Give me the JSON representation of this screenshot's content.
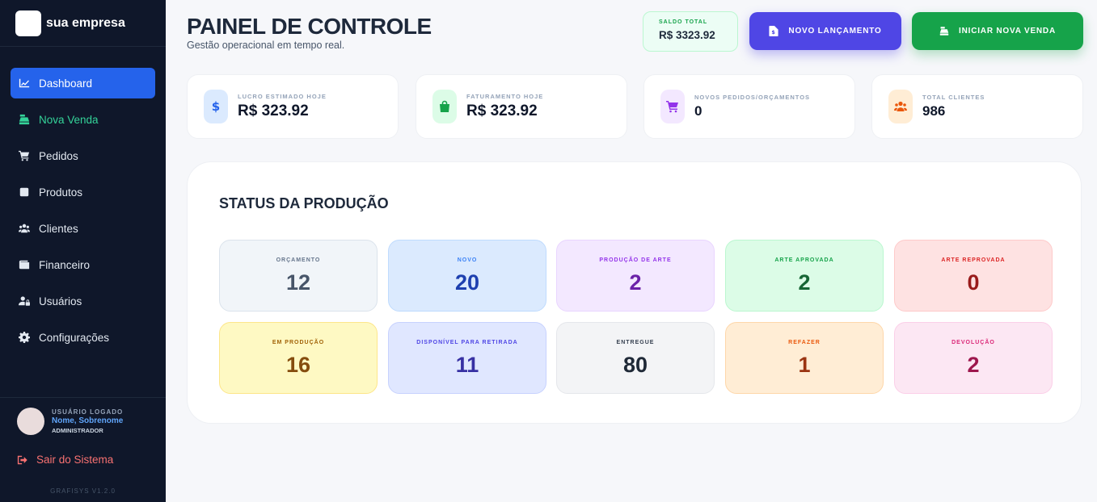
{
  "brand": {
    "name": "sua empresa"
  },
  "sidebar": {
    "items": [
      {
        "label": "Dashboard",
        "icon": "chart-line-icon"
      },
      {
        "label": "Nova Venda",
        "icon": "cash-register-icon"
      },
      {
        "label": "Pedidos",
        "icon": "cart-icon"
      },
      {
        "label": "Produtos",
        "icon": "box-icon"
      },
      {
        "label": "Clientes",
        "icon": "users-icon"
      },
      {
        "label": "Financeiro",
        "icon": "wallet-icon"
      },
      {
        "label": "Usuários",
        "icon": "user-lock-icon"
      },
      {
        "label": "Configurações",
        "icon": "gear-icon"
      }
    ],
    "active_index": 0,
    "user": {
      "caption": "USUÁRIO LOGADO",
      "name": "Nome, Sobrenome",
      "role": "ADMINISTRADOR"
    },
    "logout_label": "Sair do Sistema",
    "version": "GRAFISYS V1.2.0"
  },
  "header": {
    "title": "PAINEL DE CONTROLE",
    "subtitle": "Gestão operacional em tempo real.",
    "saldo": {
      "caption": "SALDO TOTAL",
      "value": "R$ 3323.92"
    },
    "btn_lancamento": "NOVO LANÇAMENTO",
    "btn_venda": "INICIAR NOVA VENDA"
  },
  "stats": [
    {
      "caption": "LUCRO ESTIMADO HOJE",
      "value": "R$ 323.92",
      "icon": "dollar-icon",
      "color": "#2563eb"
    },
    {
      "caption": "FATURAMENTO HOJE",
      "value": "R$ 323.92",
      "icon": "shopping-bag-icon",
      "color": "#16a34a"
    },
    {
      "caption": "NOVOS PEDIDOS/ORÇAMENTOS",
      "value": "0",
      "icon": "cart-icon",
      "color": "#9333ea"
    },
    {
      "caption": "TOTAL CLIENTES",
      "value": "986",
      "icon": "users-icon",
      "color": "#ea580c"
    }
  ],
  "production": {
    "title": "STATUS DA PRODUÇÃO",
    "tiles": [
      {
        "label": "ORÇAMENTO",
        "value": "12",
        "bg": "#f1f5f9",
        "border": "#dbe3ec",
        "cap": "#64748b",
        "val": "#475569"
      },
      {
        "label": "NOVO",
        "value": "20",
        "bg": "#dbeafe",
        "border": "#bfdbfe",
        "cap": "#3b82f6",
        "val": "#1e40af"
      },
      {
        "label": "PRODUÇÃO DE ARTE",
        "value": "2",
        "bg": "#f3e8ff",
        "border": "#e9d5ff",
        "cap": "#9333ea",
        "val": "#6b21a8"
      },
      {
        "label": "ARTE APROVADA",
        "value": "2",
        "bg": "#dcfce7",
        "border": "#bbf7d0",
        "cap": "#16a34a",
        "val": "#166534"
      },
      {
        "label": "ARTE REPROVADA",
        "value": "0",
        "bg": "#fee2e2",
        "border": "#fecaca",
        "cap": "#dc2626",
        "val": "#991b1b"
      },
      {
        "label": "EM PRODUÇÃO",
        "value": "16",
        "bg": "#fef9c3",
        "border": "#fde68a",
        "cap": "#a16207",
        "val": "#854d0e"
      },
      {
        "label": "DISPONÍVEL PARA RETIRADA",
        "value": "11",
        "bg": "#e0e7ff",
        "border": "#c7d2fe",
        "cap": "#4f46e5",
        "val": "#3730a3"
      },
      {
        "label": "ENTREGUE",
        "value": "80",
        "bg": "#f3f4f6",
        "border": "#e5e7eb",
        "cap": "#374151",
        "val": "#1f2937"
      },
      {
        "label": "REFAZER",
        "value": "1",
        "bg": "#ffedd5",
        "border": "#fed7aa",
        "cap": "#ea580c",
        "val": "#9a3412"
      },
      {
        "label": "DEVOLUÇÃO",
        "value": "2",
        "bg": "#fce7f3",
        "border": "#fbcfe8",
        "cap": "#db2777",
        "val": "#9d174d"
      }
    ]
  }
}
